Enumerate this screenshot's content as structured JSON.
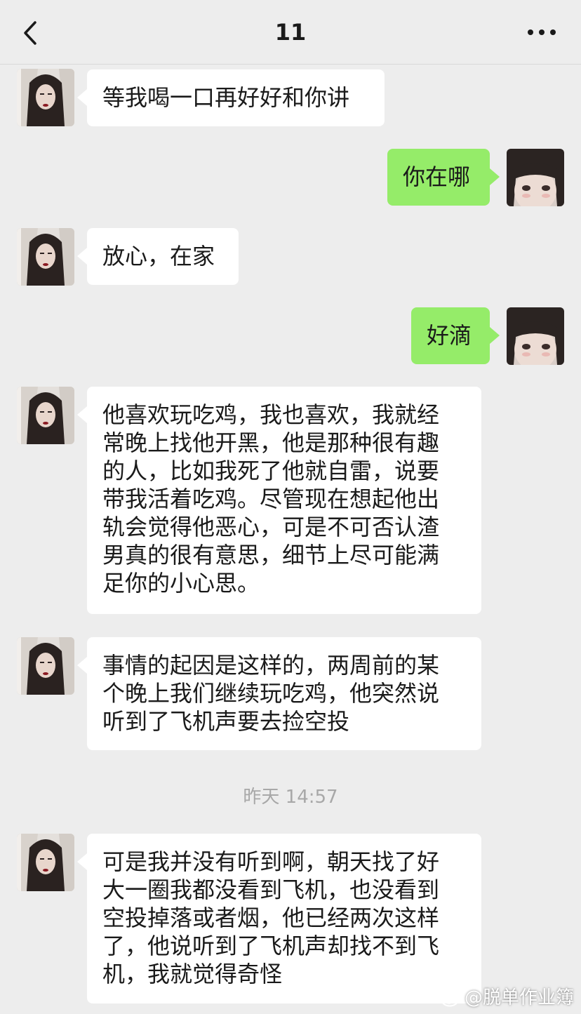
{
  "header": {
    "title": "11"
  },
  "messages": [
    {
      "from": "other",
      "lines": [
        "等我喝一口再好好和你讲"
      ]
    },
    {
      "from": "self",
      "lines": [
        "你在哪"
      ]
    },
    {
      "from": "other",
      "lines": [
        "放心，在家"
      ]
    },
    {
      "from": "self",
      "lines": [
        "好滴"
      ]
    },
    {
      "from": "other",
      "lines": [
        "他喜欢玩吃鸡，我也喜欢，我就经",
        "常晚上找他开黑，他是那种很有趣",
        "的人，比如我死了他就自雷，说要",
        "带我活着吃鸡。尽管现在想起他出",
        "轨会觉得他恶心，可是不可否认渣",
        "男真的很有意思，细节上尽可能满",
        "足你的小心思。"
      ]
    },
    {
      "from": "other",
      "lines": [
        "事情的起因是这样的，两周前的某",
        "个晚上我们继续玩吃鸡，他突然说",
        "听到了飞机声要去捡空投"
      ]
    },
    {
      "from": "other",
      "lines": [
        "可是我并没有听到啊，朝天找了好",
        "大一圈我都没看到飞机，也没看到",
        "空投掉落或者烟，他已经两次这样",
        "了，他说听到了飞机声却找不到飞",
        "机，我就觉得奇怪"
      ]
    }
  ],
  "timestamp": "昨天 14:57",
  "watermark": "@脱单作业簿",
  "colors": {
    "background": "#ededed",
    "self_bubble": "#95ec69",
    "other_bubble": "#ffffff"
  },
  "icons": {
    "back": "chevron-left-icon",
    "more": "more-dots-icon",
    "watermark": "weibo-icon"
  }
}
